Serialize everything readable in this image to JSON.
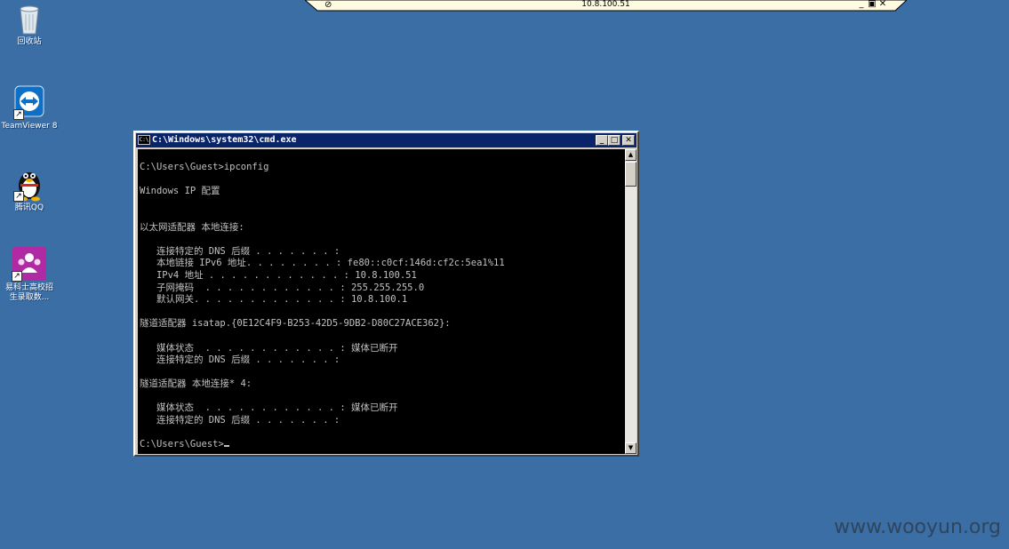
{
  "rdp_bar": {
    "host": "10.8.100.51",
    "pin_icon": "pin-icon",
    "min": "_",
    "restore": "🗗",
    "close": "✕"
  },
  "desktop_icons": [
    {
      "name": "recycle-bin",
      "label": "回收站",
      "icon": "recycle-bin-icon"
    },
    {
      "name": "teamviewer",
      "label": "TeamViewer 8",
      "icon": "teamviewer-icon"
    },
    {
      "name": "qq",
      "label": "腾讯QQ",
      "icon": "qq-penguin-icon"
    },
    {
      "name": "recruit",
      "label_line1": "易科士高校招",
      "label_line2": "生录取数...",
      "icon": "people-icon"
    }
  ],
  "cmd": {
    "title": "C:\\Windows\\system32\\cmd.exe",
    "appicon_text": "C:\\",
    "lines": [
      "",
      "C:\\Users\\Guest>ipconfig",
      "",
      "Windows IP 配置",
      "",
      "",
      "以太网适配器 本地连接:",
      "",
      "   连接特定的 DNS 后缀 . . . . . . . :",
      "   本地链接 IPv6 地址. . . . . . . . : fe80::c0cf:146d:cf2c:5ea1%11",
      "   IPv4 地址 . . . . . . . . . . . . : 10.8.100.51",
      "   子网掩码  . . . . . . . . . . . . : 255.255.255.0",
      "   默认网关. . . . . . . . . . . . . : 10.8.100.1",
      "",
      "隧道适配器 isatap.{0E12C4F9-B253-42D5-9DB2-D80C27ACE362}:",
      "",
      "   媒体状态  . . . . . . . . . . . . : 媒体已断开",
      "   连接特定的 DNS 后缀 . . . . . . . :",
      "",
      "隧道适配器 本地连接* 4:",
      "",
      "   媒体状态  . . . . . . . . . . . . : 媒体已断开",
      "   连接特定的 DNS 后缀 . . . . . . . :",
      "",
      "C:\\Users\\Guest>"
    ]
  },
  "watermark": "www.wooyun.org"
}
